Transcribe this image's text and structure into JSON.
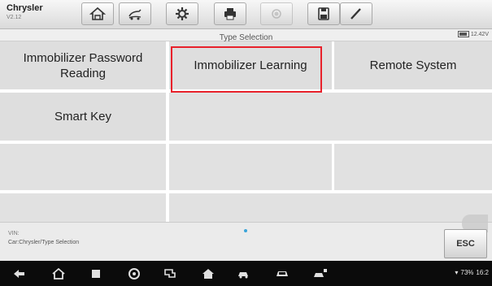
{
  "app": {
    "brand": "Chrysler",
    "version": "V2.12"
  },
  "toolbar": {
    "buttons": [
      {
        "icon": "home-icon"
      },
      {
        "icon": "vehicle-swap-icon"
      },
      {
        "icon": "gear-icon"
      },
      {
        "icon": "printer-icon"
      },
      {
        "icon": "record-icon"
      },
      {
        "icon": "save-icon"
      },
      {
        "icon": "pen-icon"
      }
    ]
  },
  "header": {
    "title": "Type Selection",
    "battery": "12.42V"
  },
  "options": [
    {
      "label": "Immobilizer Password Reading"
    },
    {
      "label": "Immobilizer Learning"
    },
    {
      "label": "Remote System"
    },
    {
      "label": "Smart Key"
    }
  ],
  "selected": "Immobilizer Learning",
  "footer": {
    "vin": "VIN:",
    "path": "Car:Chrysler/Type Selection",
    "esc": "ESC"
  },
  "status": {
    "text": "73%",
    "time": "16:2"
  },
  "colors": {
    "highlight": "#e8212b",
    "accent": "#3aa4d9"
  }
}
